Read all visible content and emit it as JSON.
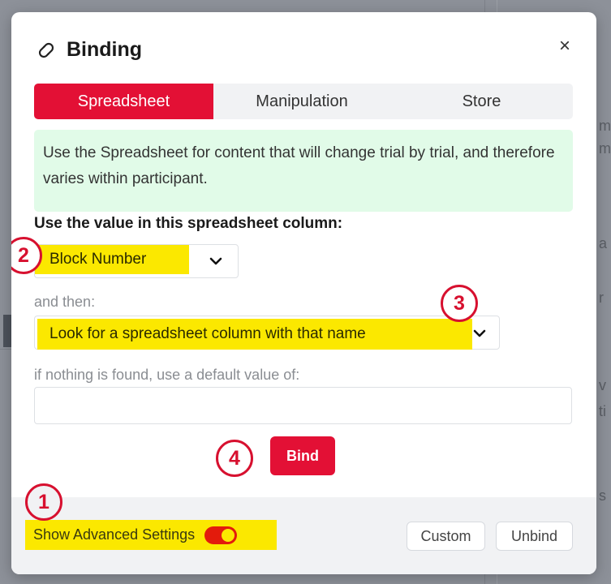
{
  "dialog": {
    "title": "Binding",
    "title_icon": "link-icon",
    "close_label": "×"
  },
  "tabs": [
    {
      "label": "Spreadsheet",
      "active": true
    },
    {
      "label": "Manipulation",
      "active": false
    },
    {
      "label": "Store",
      "active": false
    }
  ],
  "info_text": "Use the Spreadsheet for content that will change trial by trial, and therefore varies within participant.",
  "column_label": "Use the value in this spreadsheet column:",
  "column_select": {
    "value": "Block Number",
    "icon": "chevron-down-icon"
  },
  "then_label": "and then:",
  "then_select": {
    "value": "Look for a spreadsheet column with that name",
    "icon": "chevron-down-icon"
  },
  "default_label": "if nothing is found, use a default value of:",
  "default_input": {
    "value": "",
    "placeholder": ""
  },
  "bind_button": "Bind",
  "footer": {
    "advanced_label": "Show Advanced Settings",
    "advanced_toggle_on": true,
    "custom_button": "Custom",
    "unbind_button": "Unbind"
  },
  "annotations": [
    "1",
    "2",
    "3",
    "4"
  ],
  "colors": {
    "accent": "#e31035",
    "highlight": "#fbe800",
    "info_bg": "#e1fbe8",
    "annotation": "#d7102f"
  },
  "background_fragments": [
    "m",
    "m",
    "a",
    "r",
    "v",
    "ti",
    "s"
  ]
}
